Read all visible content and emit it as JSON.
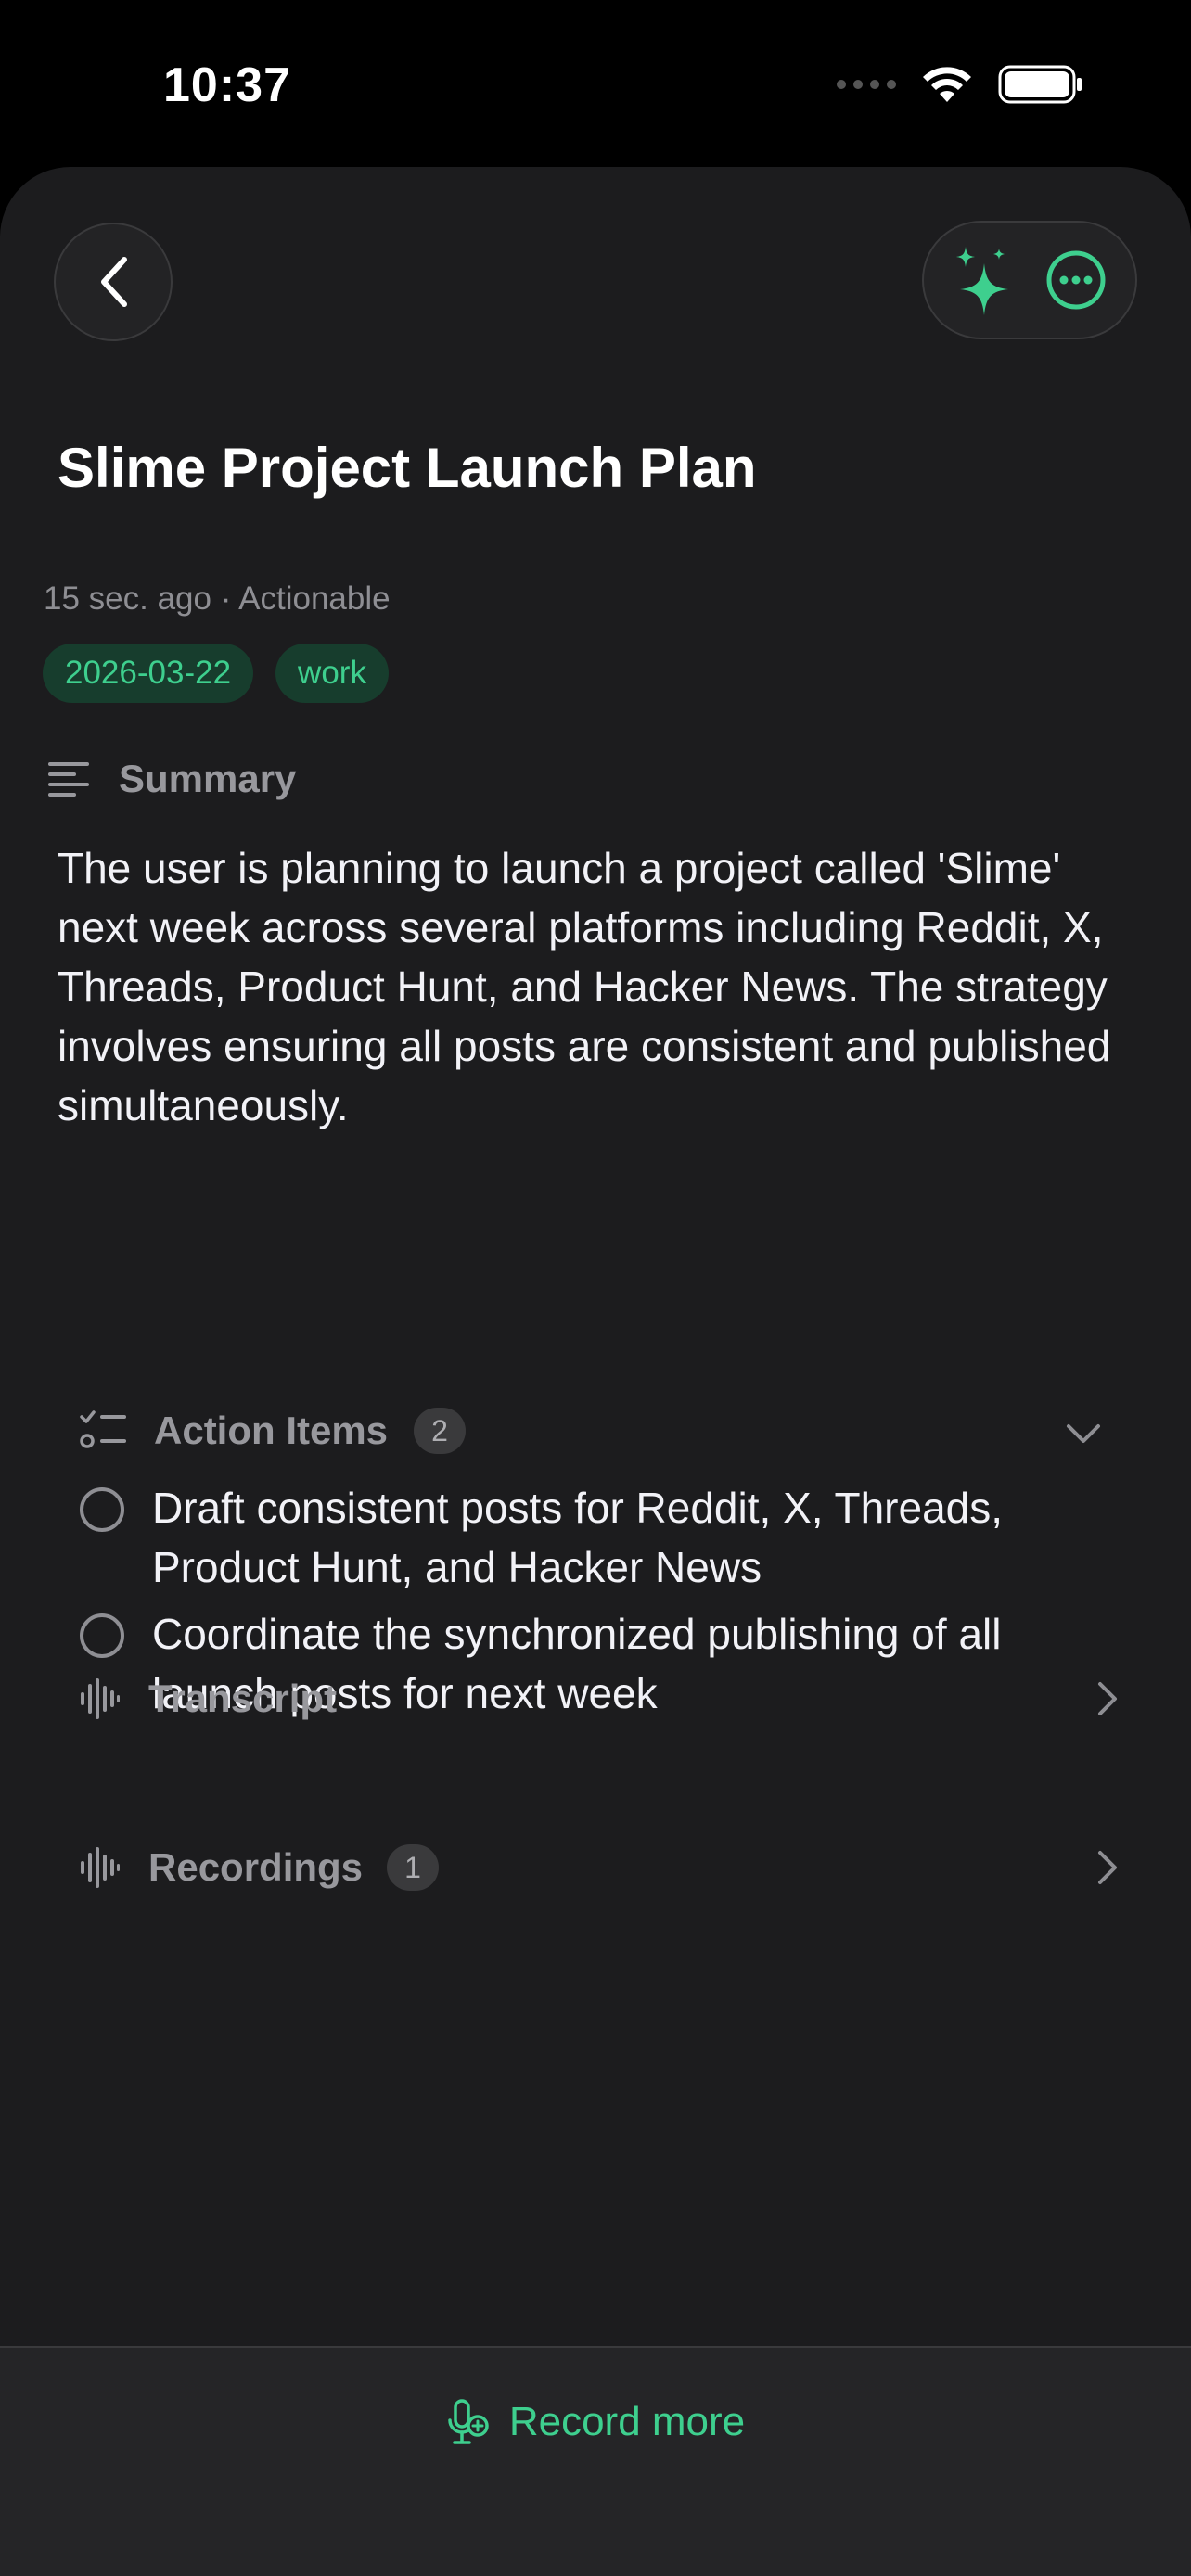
{
  "status_bar": {
    "time": "10:37"
  },
  "note": {
    "title": "Slime Project Launch Plan",
    "meta": "15 sec. ago · Actionable",
    "tags": [
      "2026-03-22",
      "work"
    ]
  },
  "summary": {
    "heading": "Summary",
    "text": "The user is planning to launch a project called 'Slime' next week across several platforms including Reddit, X, Threads, Product Hunt, and Hacker News. The strategy involves ensuring all posts are consistent and published simultaneously."
  },
  "action_items": {
    "heading": "Action Items",
    "count": "2",
    "items": [
      {
        "text": "Draft consistent posts for Reddit, X, Threads, Product Hunt, and Hacker News"
      },
      {
        "text": "Coordinate the synchronized publishing of all launch posts for next week"
      }
    ]
  },
  "transcript": {
    "label": "Transcript"
  },
  "recordings": {
    "label": "Recordings",
    "count": "1"
  },
  "bottom": {
    "record_label": "Record more"
  },
  "colors": {
    "accent": "#3ecf8e",
    "background": "#1c1c1e",
    "tag_bg": "#173d2d"
  }
}
